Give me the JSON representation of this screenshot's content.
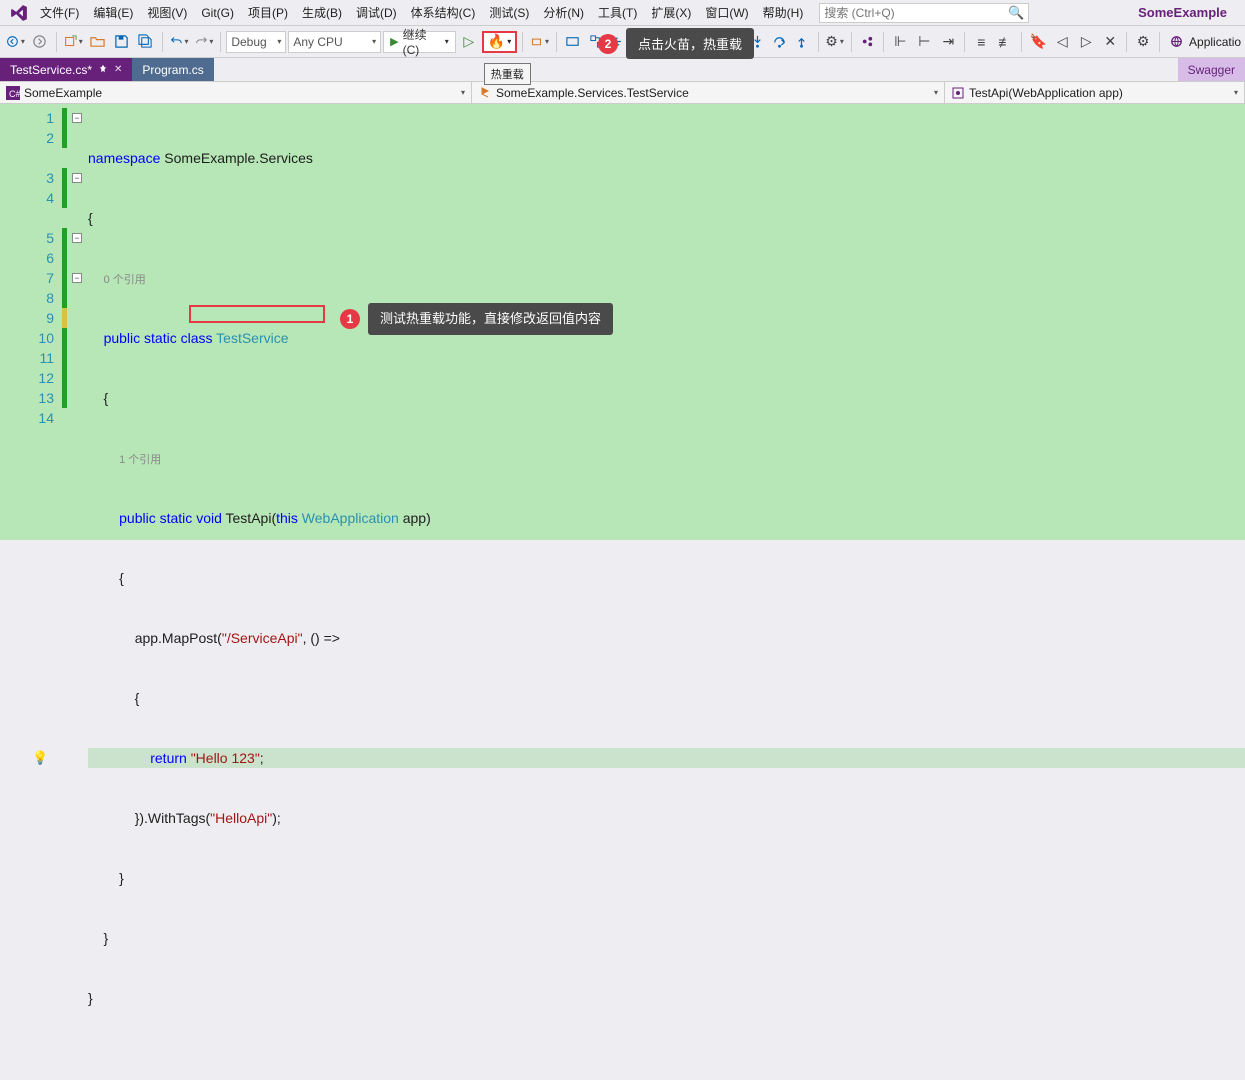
{
  "menu": {
    "items": [
      "文件(F)",
      "编辑(E)",
      "视图(V)",
      "Git(G)",
      "项目(P)",
      "生成(B)",
      "调试(D)",
      "体系结构(C)",
      "测试(S)",
      "分析(N)",
      "工具(T)",
      "扩展(X)",
      "窗口(W)",
      "帮助(H)"
    ]
  },
  "search": {
    "placeholder": "搜索 (Ctrl+Q)"
  },
  "solution_name": "SomeExample",
  "toolbar": {
    "config": "Debug",
    "platform": "Any CPU",
    "run_label": "继续(C)",
    "hot_tooltip": "热重载",
    "app_label": "Applicatio"
  },
  "tabs": {
    "active": "TestService.cs*",
    "inactive": "Program.cs",
    "right": "Swagger"
  },
  "nav": {
    "a": "SomeExample",
    "b": "SomeExample.Services.TestService",
    "c": "TestApi(WebApplication app)"
  },
  "code": {
    "lines": [
      "1",
      "2",
      "3",
      "4",
      "5",
      "6",
      "7",
      "8",
      "9",
      "10",
      "11",
      "12",
      "13",
      "14"
    ],
    "ns": "namespace",
    "ns_name": "SomeExample.Services",
    "ref0": "0 个引用",
    "ref1": "1 个引用",
    "pub": "public",
    "stat": "static",
    "cls": "class",
    "cls_name": "TestService",
    "voi": "void",
    "method": "TestApi",
    "this": "this",
    "webapp": "WebApplication",
    "arg": "app",
    "map": "app.MapPost(",
    "url": "\"/ServiceApi\"",
    "lam": ", () =>",
    "ret": "return",
    "retval": "\"Hello 123\"",
    "semi": ";",
    "tags": "}).WithTags(",
    "tagval": "\"HelloApi\"",
    "tagend": ");"
  },
  "callouts": {
    "c1_num": "1",
    "c1_text": "测试热重载功能，直接修改返回值内容",
    "c2_num": "2",
    "c2_text": "点击火苗，热重载"
  }
}
